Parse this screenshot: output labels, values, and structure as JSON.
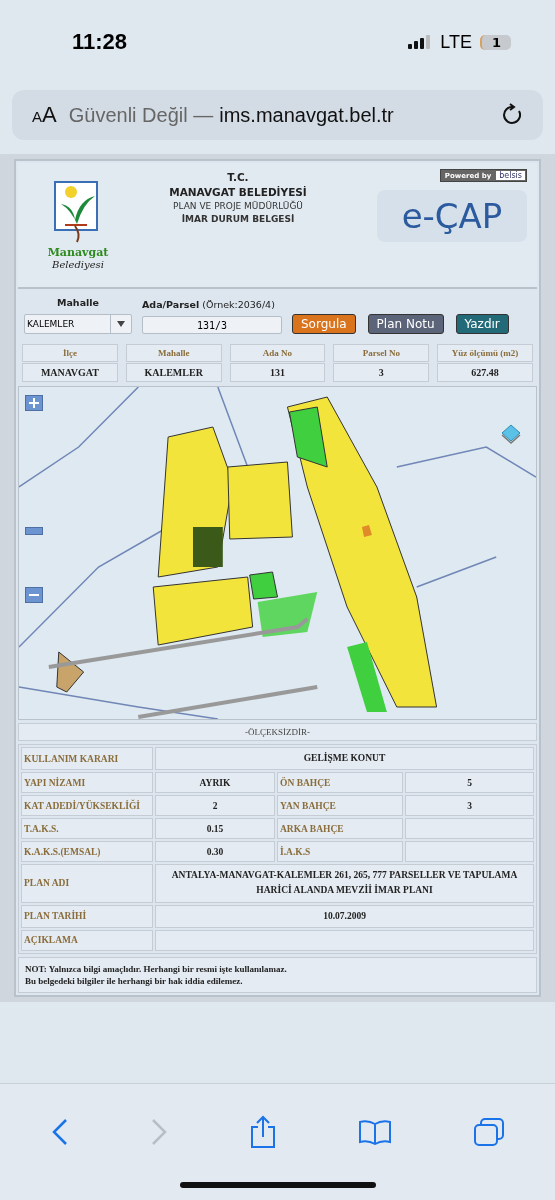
{
  "status_bar": {
    "time": "11:28",
    "network": "LTE",
    "battery": "1"
  },
  "address_bar": {
    "text_size": "AA",
    "security": "Güvenli Değil —",
    "host": "ims.manavgat.bel.tr"
  },
  "header": {
    "logo_name": "Manavgat",
    "logo_sub": "Belediyesi",
    "powered_label": "Powered by",
    "powered_brand": "belsis",
    "lines": [
      "T.C.",
      "MANAVGAT BELEDİYESİ",
      "PLAN VE PROJE MÜDÜRLÜĞÜ",
      "İMAR DURUM BELGESİ"
    ],
    "app_logo": "e-ÇAP"
  },
  "form": {
    "neighborhood_label": "Mahalle",
    "neighborhood_value": "KALEMLER",
    "parcel_label": "**Ada/Parsel** (Örnek:2036/4)",
    "parcel_value": "131/3",
    "buttons": [
      {
        "label": "Sorgula",
        "color": "#d9731c"
      },
      {
        "label": "Plan Notu",
        "color": "#5b6478"
      },
      {
        "label": "Yazdır",
        "color": "#236a78"
      }
    ]
  },
  "summary": {
    "columns": [
      "İlçe",
      "Mahalle",
      "Ada No",
      "Parsel No",
      "Yüz ölçümü (m2)"
    ],
    "values": [
      "MANAVGAT",
      "KALEMLER",
      "131",
      "3",
      "627.48"
    ]
  },
  "map": {
    "kind": "picture",
    "scale_note": "-ÖLÇEKSİZDİR-"
  },
  "details": [
    {
      "kind": "wide",
      "label": "KULLANIM KARARI",
      "value": "GELİŞME KONUT"
    },
    {
      "kind": "pair",
      "label": "YAPI NİZAMI",
      "value": "AYRIK",
      "label2": "ÖN BAHÇE",
      "value2": "5"
    },
    {
      "kind": "pair",
      "label": "KAT ADEDİ/YÜKSEKLİĞİ",
      "value": "2",
      "label2": "YAN BAHÇE",
      "value2": "3"
    },
    {
      "kind": "pair",
      "label": "T.A.K.S.",
      "value": "0.15",
      "label2": "ARKA BAHÇE"
    },
    {
      "kind": "pair",
      "label": "K.A.K.S.(EMSAL)",
      "value": "0.30",
      "label2": "İ.A.K.S"
    },
    {
      "kind": "wide",
      "label": "PLAN ADI",
      "value": "ANTALYA-MANAVGAT-KALEMLER 261, 265, 777 PARSELLER VE TAPULAMA HARİCİ ALANDA MEVZİİ İMAR PLANI"
    },
    {
      "kind": "wide",
      "label": "PLAN TARİHİ",
      "value": "10.07.2009"
    },
    {
      "kind": "wide",
      "label": "AÇIKLAMA"
    }
  ],
  "note": [
    "NOT: Yalnızca bilgi amaçlıdır. Herhangi bir resmi işte kullanılamaz.",
    "Bu belgedeki bilgiler ile herhangi bir hak iddia edilemez."
  ],
  "toolbar": [
    {
      "kind": "back",
      "disabled": false
    },
    {
      "kind": "forward",
      "disabled": true
    },
    {
      "kind": "share",
      "disabled": false
    },
    {
      "kind": "bookmarks",
      "disabled": false
    },
    {
      "kind": "tabs",
      "disabled": false
    }
  ]
}
